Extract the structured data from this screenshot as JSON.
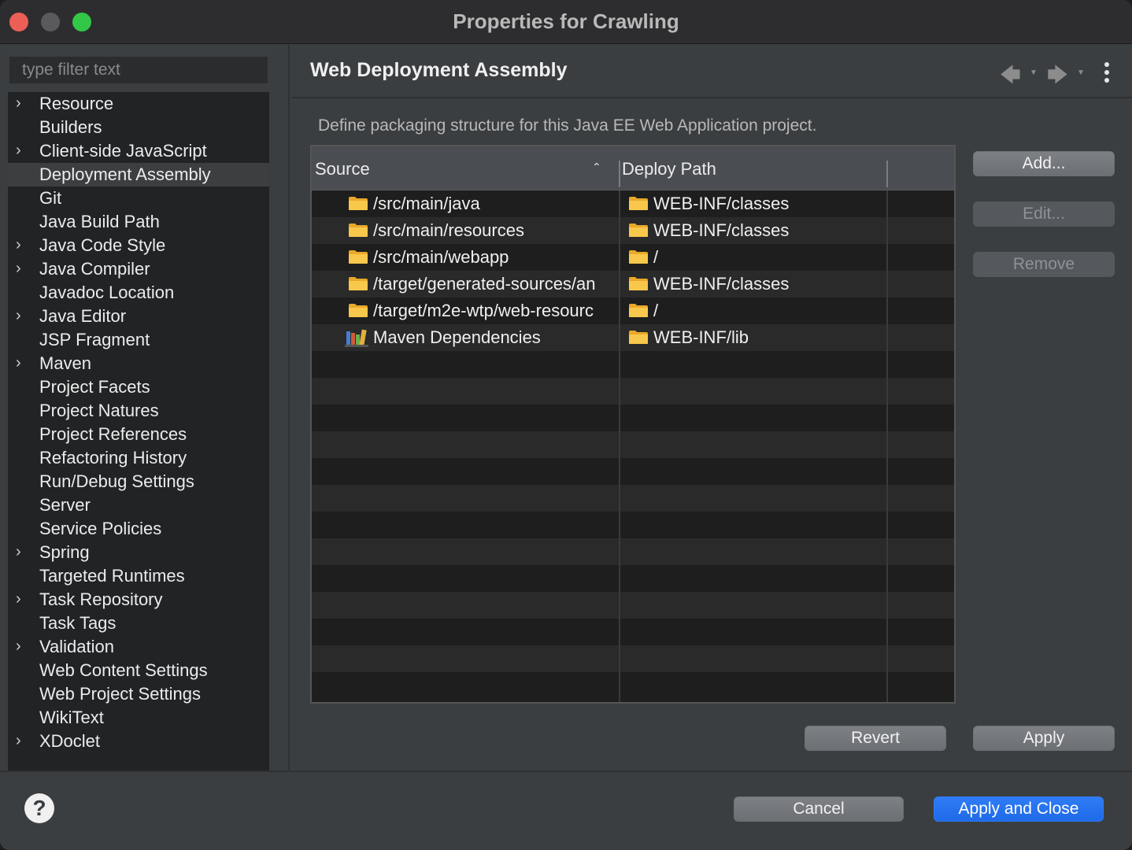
{
  "window": {
    "title": "Properties for Crawling"
  },
  "filter": {
    "placeholder": "type filter text"
  },
  "tree": {
    "items": [
      {
        "label": "Resource",
        "expandable": true
      },
      {
        "label": "Builders",
        "expandable": false
      },
      {
        "label": "Client-side JavaScript",
        "expandable": true
      },
      {
        "label": "Deployment Assembly",
        "expandable": false,
        "selected": true
      },
      {
        "label": "Git",
        "expandable": false
      },
      {
        "label": "Java Build Path",
        "expandable": false
      },
      {
        "label": "Java Code Style",
        "expandable": true
      },
      {
        "label": "Java Compiler",
        "expandable": true
      },
      {
        "label": "Javadoc Location",
        "expandable": false
      },
      {
        "label": "Java Editor",
        "expandable": true
      },
      {
        "label": "JSP Fragment",
        "expandable": false
      },
      {
        "label": "Maven",
        "expandable": true
      },
      {
        "label": "Project Facets",
        "expandable": false
      },
      {
        "label": "Project Natures",
        "expandable": false
      },
      {
        "label": "Project References",
        "expandable": false
      },
      {
        "label": "Refactoring History",
        "expandable": false
      },
      {
        "label": "Run/Debug Settings",
        "expandable": false
      },
      {
        "label": "Server",
        "expandable": false
      },
      {
        "label": "Service Policies",
        "expandable": false
      },
      {
        "label": "Spring",
        "expandable": true
      },
      {
        "label": "Targeted Runtimes",
        "expandable": false
      },
      {
        "label": "Task Repository",
        "expandable": true
      },
      {
        "label": "Task Tags",
        "expandable": false
      },
      {
        "label": "Validation",
        "expandable": true
      },
      {
        "label": "Web Content Settings",
        "expandable": false
      },
      {
        "label": "Web Project Settings",
        "expandable": false
      },
      {
        "label": "WikiText",
        "expandable": false
      },
      {
        "label": "XDoclet",
        "expandable": true
      }
    ]
  },
  "page": {
    "title": "Web Deployment Assembly",
    "description": "Define packaging structure for this Java EE Web Application project."
  },
  "table": {
    "columns": {
      "source": "Source",
      "deploy_path": "Deploy Path"
    },
    "rows": [
      {
        "source": "/src/main/java",
        "deploy_path": "WEB-INF/classes",
        "source_icon": "folder-icon"
      },
      {
        "source": "/src/main/resources",
        "deploy_path": "WEB-INF/classes",
        "source_icon": "folder-icon"
      },
      {
        "source": "/src/main/webapp",
        "deploy_path": "/",
        "source_icon": "folder-icon"
      },
      {
        "source": "/target/generated-sources/an",
        "deploy_path": "WEB-INF/classes",
        "source_icon": "folder-icon"
      },
      {
        "source": "/target/m2e-wtp/web-resourc",
        "deploy_path": "/",
        "source_icon": "folder-icon"
      },
      {
        "source": "Maven Dependencies",
        "deploy_path": "WEB-INF/lib",
        "source_icon": "library-icon"
      }
    ]
  },
  "buttons": {
    "add": "Add...",
    "edit": "Edit...",
    "remove": "Remove",
    "revert": "Revert",
    "apply": "Apply",
    "cancel": "Cancel",
    "apply_close": "Apply and Close"
  },
  "colors": {
    "primary": "#1f6ae8",
    "folder": "#f5c342"
  }
}
